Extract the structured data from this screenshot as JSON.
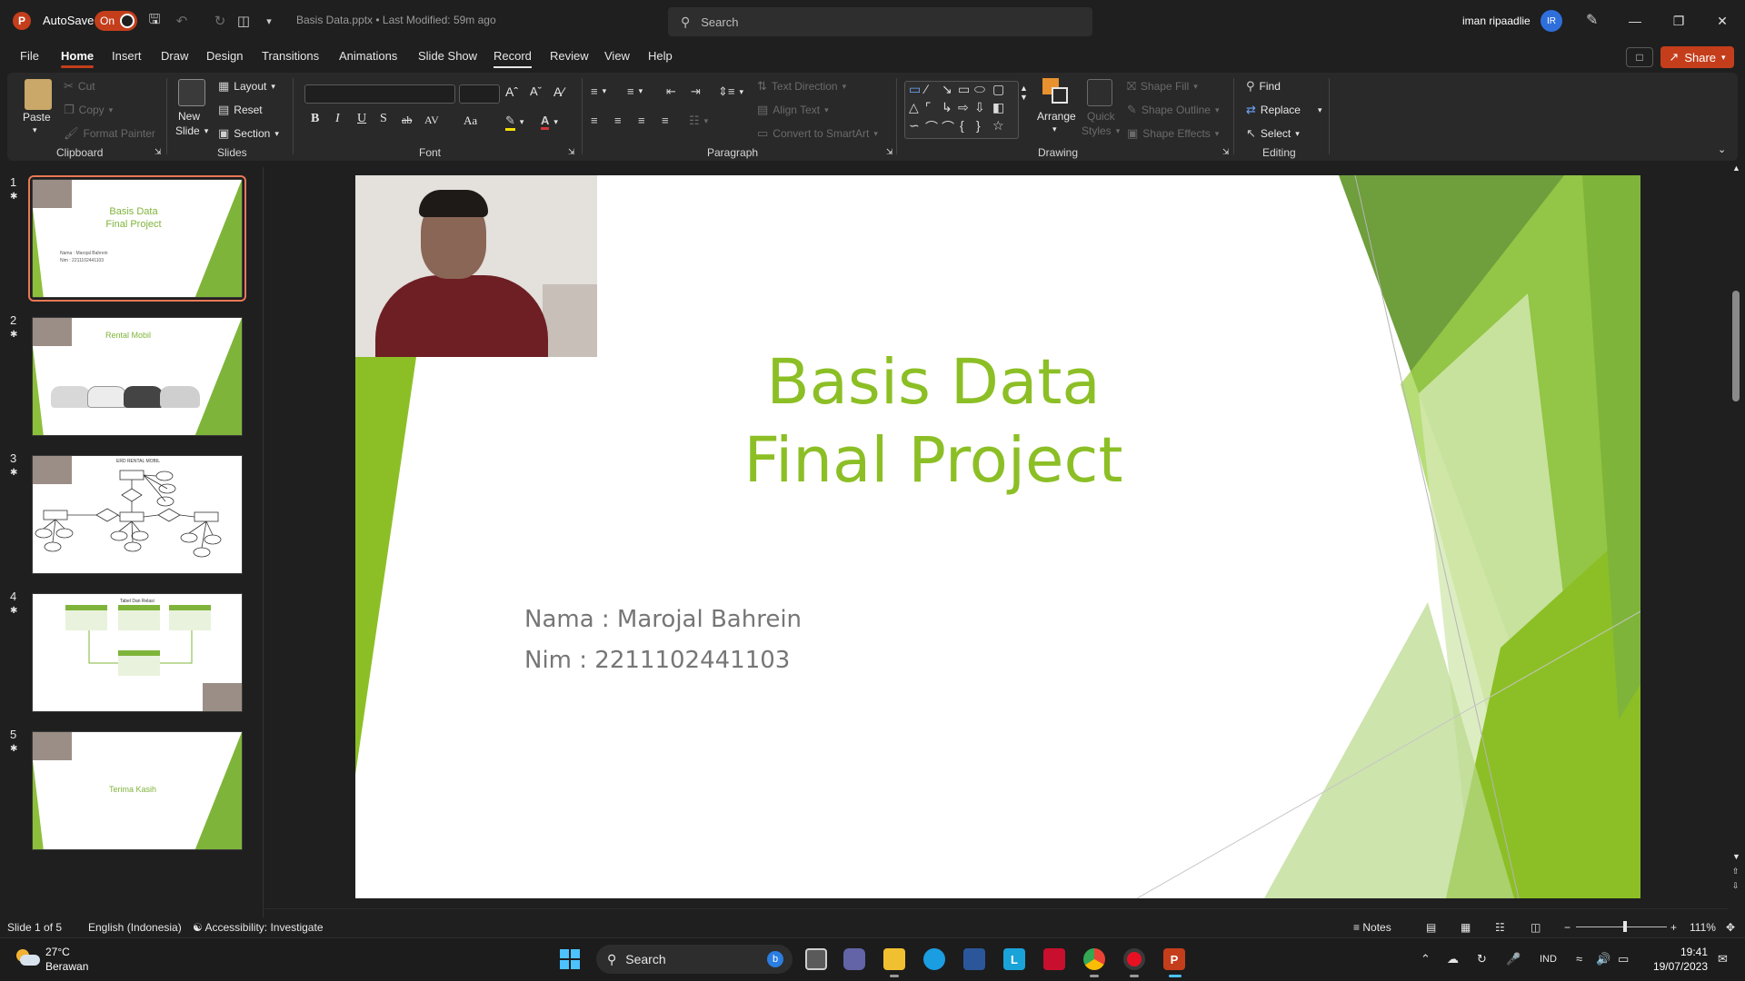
{
  "titlebar": {
    "app_letter": "P",
    "autosave_label": "AutoSave",
    "autosave_state": "On",
    "doc_title": "Basis Data.pptx • Last Modified: 59m ago",
    "search_placeholder": "Search",
    "username": "iman ripaadlie",
    "avatar_initials": "IR"
  },
  "tabs": [
    "File",
    "Home",
    "Insert",
    "Draw",
    "Design",
    "Transitions",
    "Animations",
    "Slide Show",
    "Record",
    "Review",
    "View",
    "Help"
  ],
  "share_label": "Share",
  "ribbon": {
    "clipboard": {
      "paste": "Paste",
      "cut": "Cut",
      "copy": "Copy",
      "format_painter": "Format Painter",
      "label": "Clipboard"
    },
    "slides": {
      "new_slide": "New",
      "new_slide_2": "Slide",
      "layout": "Layout",
      "reset": "Reset",
      "section": "Section",
      "label": "Slides"
    },
    "font": {
      "label": "Font",
      "bold": "B",
      "italic": "I",
      "underline": "U",
      "shadow": "S",
      "strike": "ab",
      "spacing": "AV",
      "case": "Aa"
    },
    "paragraph": {
      "text_direction": "Text Direction",
      "align_text": "Align Text",
      "convert_smartart": "Convert to SmartArt",
      "label": "Paragraph"
    },
    "drawing": {
      "arrange": "Arrange",
      "quick_styles": "Quick",
      "quick_styles_2": "Styles",
      "shape_fill": "Shape Fill",
      "shape_outline": "Shape Outline",
      "shape_effects": "Shape Effects",
      "label": "Drawing"
    },
    "editing": {
      "find": "Find",
      "replace": "Replace",
      "select": "Select",
      "label": "Editing"
    }
  },
  "thumbnails": [
    {
      "num": "1",
      "title_1": "Basis Data",
      "title_2": "Final Project",
      "small_1": "Nama : Marojal Bahrein",
      "small_2": "Nim : 2211102441103"
    },
    {
      "num": "2",
      "title": "Rental Mobil"
    },
    {
      "num": "3",
      "title": "ERD RENTAL MOBIL"
    },
    {
      "num": "4",
      "title": "Tabel Dan Relasi"
    },
    {
      "num": "5",
      "title": "Terima Kasih"
    }
  ],
  "slide": {
    "title_line1": "Basis Data",
    "title_line2": "Final Project",
    "nama": "Nama : Marojal Bahrein",
    "nim": "Nim : 2211102441103"
  },
  "status": {
    "slide_of": "Slide 1 of 5",
    "language": "English (Indonesia)",
    "accessibility": "Accessibility: Investigate",
    "notes": "Notes",
    "zoom": "111%"
  },
  "taskbar": {
    "temp": "27°C",
    "weather": "Berawan",
    "search": "Search",
    "lang": "IND",
    "time": "19:41",
    "date": "19/07/2023"
  },
  "colors": {
    "accent": "#c43e1c",
    "slide_green": "#8cbf26"
  }
}
